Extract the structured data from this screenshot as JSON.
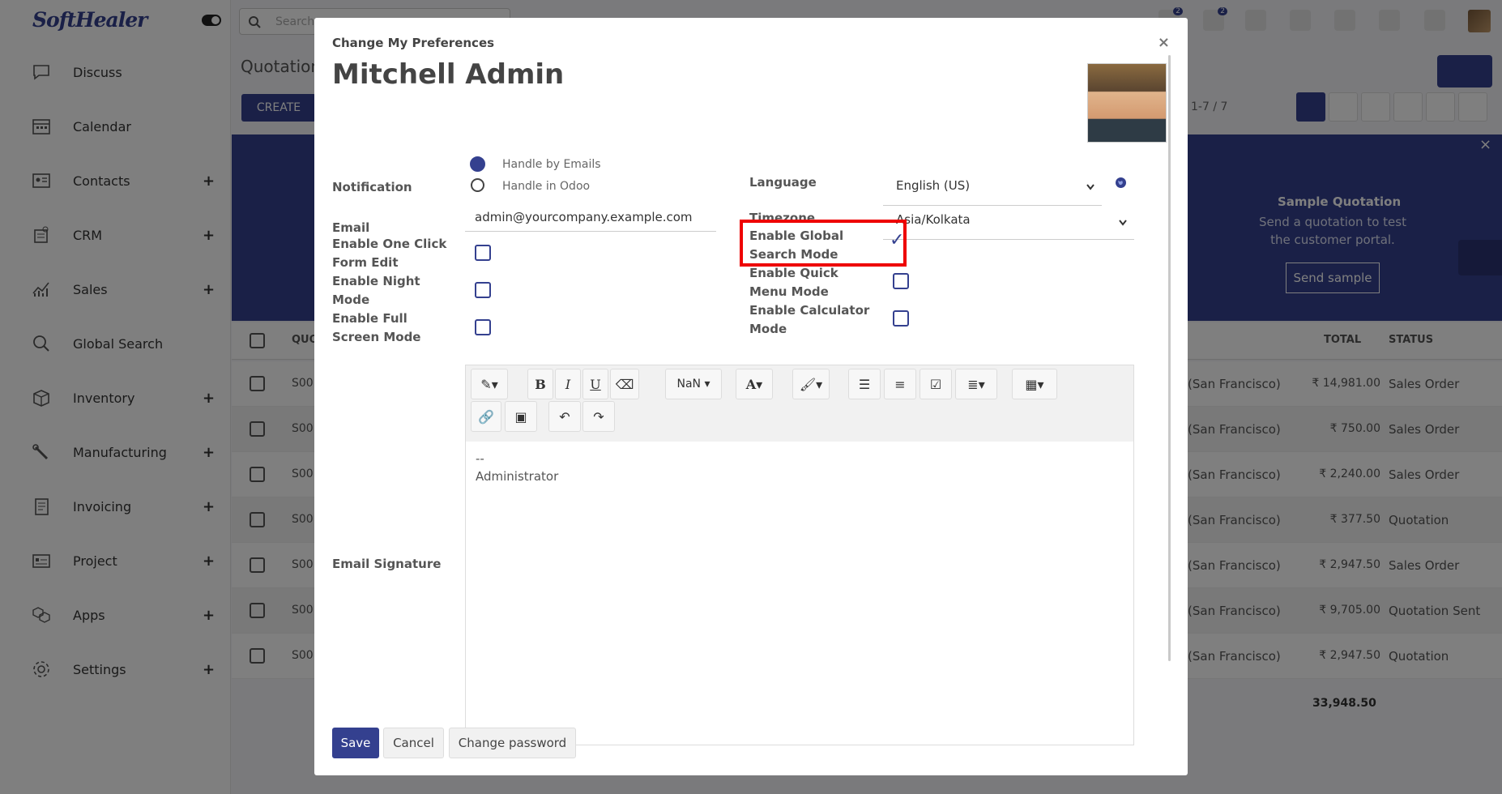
{
  "app": {
    "logo": "SoftHealer"
  },
  "sidebar": {
    "items": [
      {
        "label": "Discuss",
        "icon": "chat-icon",
        "has_plus": false
      },
      {
        "label": "Calendar",
        "icon": "calendar-icon",
        "has_plus": false
      },
      {
        "label": "Contacts",
        "icon": "contacts-icon",
        "has_plus": true
      },
      {
        "label": "CRM",
        "icon": "crm-icon",
        "has_plus": true
      },
      {
        "label": "Sales",
        "icon": "sales-chart-icon",
        "has_plus": true
      },
      {
        "label": "Global Search",
        "icon": "search-icon",
        "has_plus": false
      },
      {
        "label": "Inventory",
        "icon": "inventory-icon",
        "has_plus": true
      },
      {
        "label": "Manufacturing",
        "icon": "wrench-icon",
        "has_plus": true
      },
      {
        "label": "Invoicing",
        "icon": "invoice-icon",
        "has_plus": true
      },
      {
        "label": "Project",
        "icon": "project-icon",
        "has_plus": true
      },
      {
        "label": "Apps",
        "icon": "apps-icon",
        "has_plus": true
      },
      {
        "label": "Settings",
        "icon": "gear-icon",
        "has_plus": true
      }
    ],
    "plus": "+"
  },
  "topbar": {
    "search_placeholder": "Search...",
    "badges": [
      "2",
      "2"
    ]
  },
  "control_panel": {
    "title": "Quotation",
    "create_label": "CREATE",
    "pager": "1-7 / 7"
  },
  "banner": {
    "title": "Sample Quotation",
    "text": "Send a quotation to test the customer portal.",
    "button": "Send sample",
    "close": "×"
  },
  "list": {
    "headers": {
      "quotation": "QUO",
      "total": "TOTAL",
      "status": "STATUS"
    },
    "rows": [
      {
        "so": "S00",
        "customer": "(San Francisco)",
        "total": "₹ 14,981.00",
        "status": "Sales Order"
      },
      {
        "so": "S00",
        "customer": "(San Francisco)",
        "total": "₹ 750.00",
        "status": "Sales Order"
      },
      {
        "so": "S00",
        "customer": "(San Francisco)",
        "total": "₹ 2,240.00",
        "status": "Sales Order"
      },
      {
        "so": "S00",
        "customer": "(San Francisco)",
        "total": "₹ 377.50",
        "status": "Quotation"
      },
      {
        "so": "S00",
        "customer": "(San Francisco)",
        "total": "₹ 2,947.50",
        "status": "Sales Order"
      },
      {
        "so": "S00",
        "customer": "(San Francisco)",
        "total": "₹ 9,705.00",
        "status": "Quotation Sent"
      },
      {
        "so": "S00",
        "customer": "(San Francisco)",
        "total": "₹ 2,947.50",
        "status": "Quotation"
      }
    ],
    "grand_total": "33,948.50"
  },
  "modal": {
    "header": "Change My Preferences",
    "close": "×",
    "user_name": "Mitchell Admin",
    "notification": {
      "label": "Notification",
      "options": [
        "Handle by Emails",
        "Handle in Odoo"
      ],
      "selected": "Handle by Emails"
    },
    "email": {
      "label": "Email",
      "value": "admin@yourcompany.example.com"
    },
    "left_checks": [
      {
        "label_1": "Enable One Click",
        "label_2": "Form Edit",
        "checked": false
      },
      {
        "label_1": "Enable Night",
        "label_2": "Mode",
        "checked": false
      },
      {
        "label_1": "Enable Full",
        "label_2": "Screen Mode",
        "checked": false
      }
    ],
    "language": {
      "label": "Language",
      "value": "English (US)"
    },
    "timezone": {
      "label": "Timezone",
      "value": "Asia/Kolkata"
    },
    "right_checks": [
      {
        "label_1": "Enable Global",
        "label_2": "Search Mode",
        "checked": true
      },
      {
        "label_1": "Enable Quick",
        "label_2": "Menu Mode",
        "checked": false
      },
      {
        "label_1": "Enable Calculator",
        "label_2": "Mode",
        "checked": false
      }
    ],
    "checkmark": "✓",
    "signature": {
      "label": "Email Signature",
      "line1": "--",
      "line2": "Administrator"
    },
    "toolbar": {
      "font_size": "NaN"
    },
    "buttons": {
      "save": "Save",
      "cancel": "Cancel",
      "change_password": "Change password"
    }
  },
  "colors": {
    "primary": "#34408f",
    "highlight": "#e00000"
  }
}
